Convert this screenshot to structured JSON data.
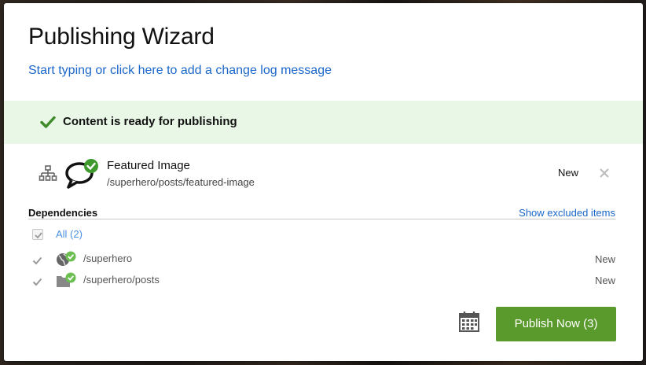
{
  "dialog": {
    "title": "Publishing Wizard",
    "changelog_link": "Start typing or click here to add a change log message"
  },
  "banner": {
    "message": "Content is ready for publishing",
    "color": "#e9f8e6"
  },
  "item": {
    "name": "Featured Image",
    "path": "/superhero/posts/featured-image",
    "status": "New",
    "icon": "chat-bubble-icon"
  },
  "dependencies": {
    "title": "Dependencies",
    "show_excluded": "Show excluded items",
    "all_label": "All (2)",
    "items": [
      {
        "path": "/superhero",
        "status": "New",
        "icon": "globe-icon"
      },
      {
        "path": "/superhero/posts",
        "status": "New",
        "icon": "folder-icon"
      }
    ]
  },
  "actions": {
    "publish_label": "Publish Now (3)",
    "publish_color": "#5a9a2c",
    "link_color": "#1a67c9"
  }
}
